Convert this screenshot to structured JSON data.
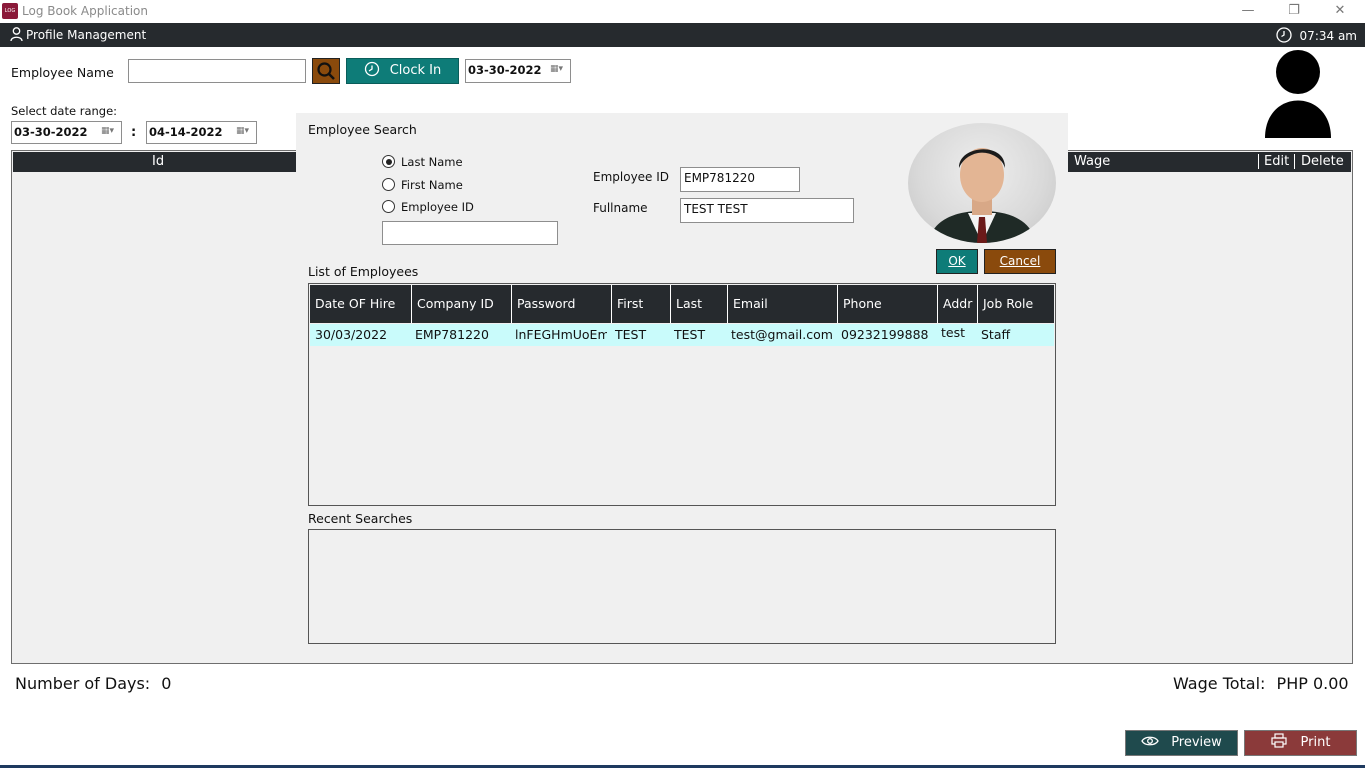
{
  "window": {
    "title": "Log Book Application",
    "icon_text": "LOG",
    "controls": {
      "minimize": "—",
      "restore": "❐",
      "close": "✕"
    }
  },
  "menubar": {
    "profile_label": "Profile Management",
    "clock_time": "07:34 am"
  },
  "toolbar": {
    "employee_name_label": "Employee Name",
    "employee_name_value": "",
    "clock_in_label": "Clock In",
    "clock_date": "03-30-2022"
  },
  "date_range": {
    "label": "Select date range:",
    "from": "03-30-2022",
    "separator": ":",
    "to": "04-14-2022"
  },
  "grid": {
    "columns": {
      "id": "Id",
      "wage": "Wage",
      "edit": "Edit",
      "delete": "Delete"
    }
  },
  "dialog": {
    "title": "Employee Search",
    "search_by": {
      "options": [
        "Last Name",
        "First Name",
        "Employee ID"
      ],
      "selected": "Last Name"
    },
    "search_value": "",
    "employee_id_label": "Employee ID",
    "employee_id_value": "EMP781220",
    "fullname_label": "Fullname",
    "fullname_value": "TEST TEST",
    "ok_label": "OK",
    "cancel_label": "Cancel",
    "list_label": "List of Employees",
    "columns": [
      "Date OF Hire",
      "Company ID",
      "Password",
      "First",
      "Last",
      "Email",
      "Phone",
      "Addr",
      "Job Role"
    ],
    "rows": [
      [
        "30/03/2022",
        "EMP781220",
        "lnFEGHmUoEm",
        "TEST",
        "TEST",
        "test@gmail.com",
        "09232199888",
        "test",
        "Staff"
      ]
    ],
    "recent_label": "Recent Searches"
  },
  "footer": {
    "days_label": "Number of Days:",
    "days_value": "0",
    "wage_label": "Wage Total:",
    "wage_value": "PHP 0.00",
    "preview_label": "Preview",
    "print_label": "Print"
  },
  "colors": {
    "accent_teal": "#0e7c78",
    "accent_brown": "#8a4a0c",
    "header_dark": "#262a2e",
    "print_red": "#8b3a3a",
    "selected_row": "#c9fbfb"
  }
}
